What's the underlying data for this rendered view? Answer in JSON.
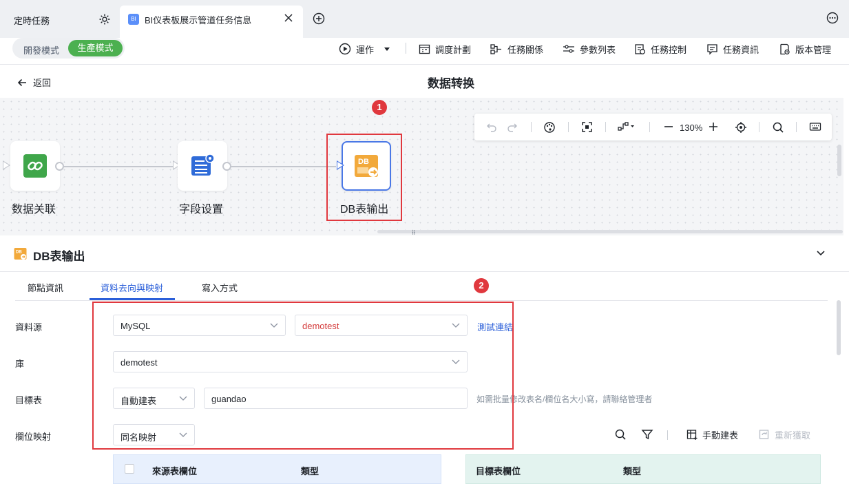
{
  "tabs": {
    "tab1_label": "定時任務",
    "tab2_label": "BI仪表板展示管道任务信息",
    "tab2_icon_text": "BI"
  },
  "toolbar": {
    "mode_dev": "開發模式",
    "mode_prod": "生產模式",
    "run": "運作",
    "schedule": "調度計劃",
    "task_relation": "任務關係",
    "param_list": "參數列表",
    "task_control": "任務控制",
    "task_info": "任務資訊",
    "version": "版本管理"
  },
  "header": {
    "back": "返回",
    "title": "数据转换"
  },
  "canvas": {
    "zoom": "130%",
    "nodes": [
      {
        "label": "数据关联"
      },
      {
        "label": "字段设置"
      },
      {
        "label": "DB表输出",
        "icon_text": "DB"
      }
    ],
    "badge1": "1"
  },
  "panel": {
    "icon_text": "DB",
    "title": "DB表输出",
    "tabs": [
      "節點資訊",
      "資料去向與映射",
      "寫入方式"
    ],
    "active_tab": "資料去向與映射",
    "badge2": "2"
  },
  "form": {
    "source_label": "資料源",
    "source_type": "MySQL",
    "source_conn": "demotest",
    "test_link": "測試連結",
    "db_label": "庫",
    "db_value": "demotest",
    "target_label": "目標表",
    "target_mode": "自動建表",
    "target_table": "guandao",
    "target_hint": "如需批量修改表名/欄位名大小寫，請聯絡管理者",
    "mapping_label": "欄位映射",
    "mapping_mode": "同名映射",
    "manual_create": "手動建表",
    "refetch": "重新獲取"
  },
  "grid": {
    "src_field": "來源表欄位",
    "src_type": "類型",
    "tgt_field": "目標表欄位",
    "tgt_type": "類型"
  },
  "colors": {
    "accent": "#2b5fd9",
    "prod_green": "#4cb050",
    "highlight_red": "#e0383e",
    "source_conn_text": "#d43b3b"
  }
}
